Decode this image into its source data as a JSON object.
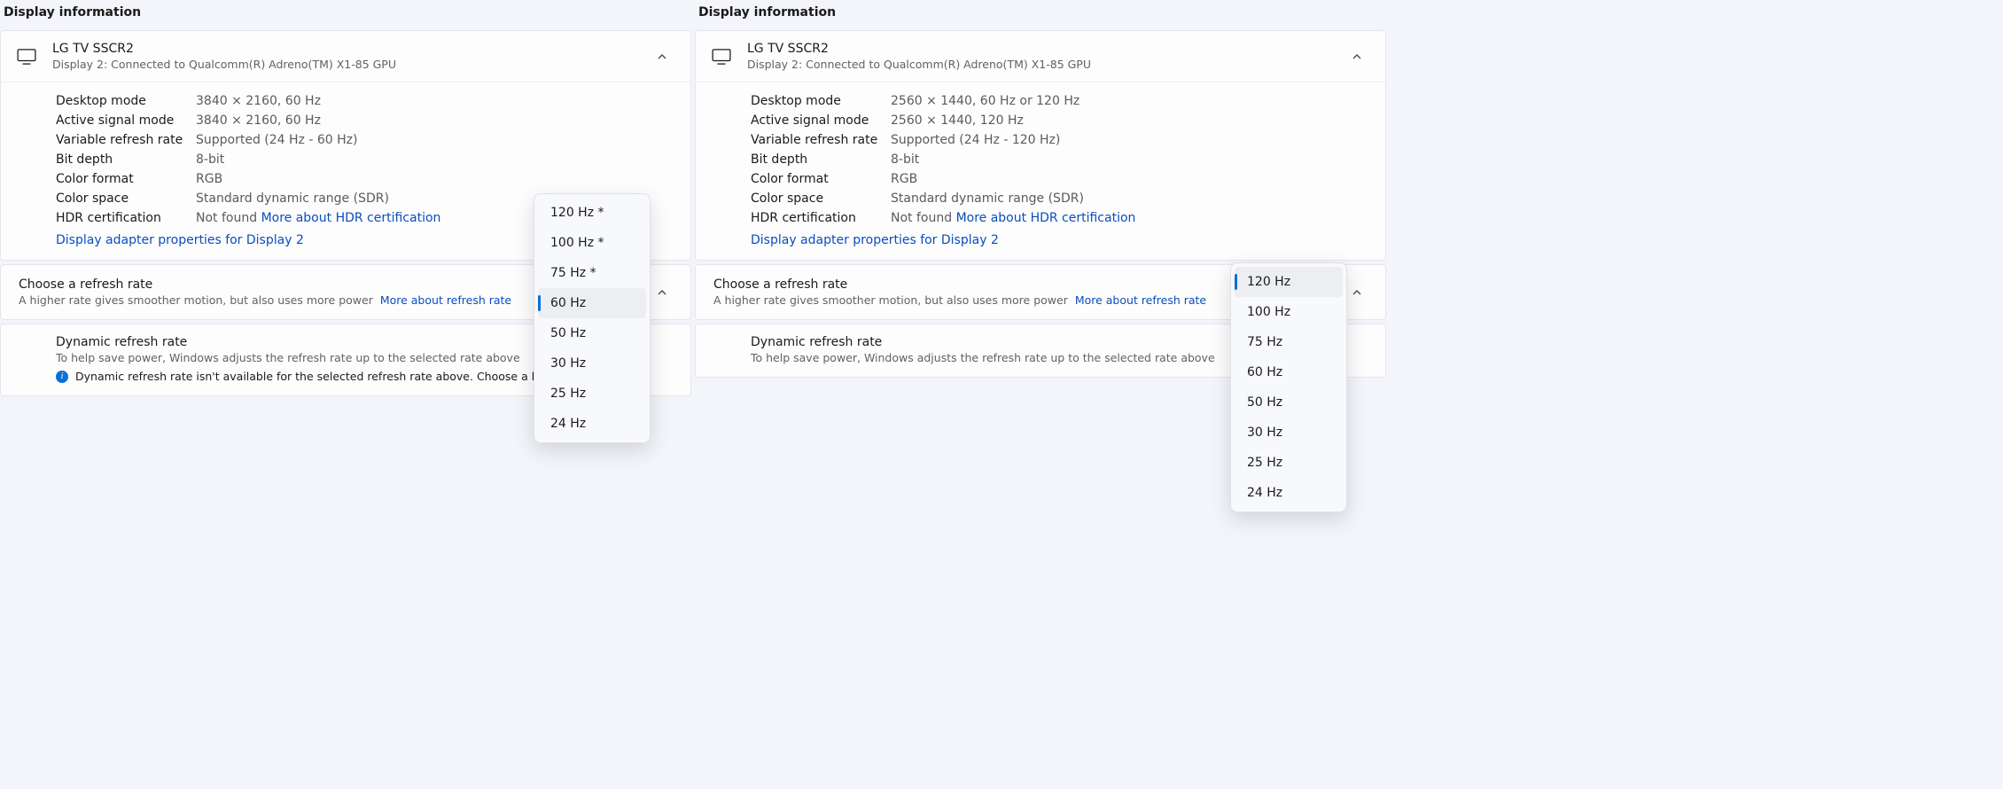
{
  "left": {
    "section_title": "Display information",
    "display": {
      "name": "LG TV SSCR2",
      "subtitle": "Display 2: Connected to Qualcomm(R) Adreno(TM) X1-85 GPU"
    },
    "props": {
      "desktop_mode": {
        "label": "Desktop mode",
        "value": "3840 × 2160, 60 Hz"
      },
      "active_signal": {
        "label": "Active signal mode",
        "value": "3840 × 2160, 60 Hz"
      },
      "vrr": {
        "label": "Variable refresh rate",
        "value": "Supported (24 Hz - 60 Hz)"
      },
      "bit_depth": {
        "label": "Bit depth",
        "value": "8-bit"
      },
      "color_format": {
        "label": "Color format",
        "value": "RGB"
      },
      "color_space": {
        "label": "Color space",
        "value": "Standard dynamic range (SDR)"
      },
      "hdr": {
        "label": "HDR certification",
        "value": "Not found",
        "link": "More about HDR certification"
      }
    },
    "adapter_link": "Display adapter properties for Display 2",
    "refresh": {
      "title": "Choose a refresh rate",
      "desc": "A higher rate gives smoother motion, but also uses more power",
      "link": "More about refresh rate"
    },
    "dynamic": {
      "title": "Dynamic refresh rate",
      "desc": "To help save power, Windows adjusts the refresh rate up to the selected rate above",
      "info": "Dynamic refresh rate isn't available for the selected refresh rate above. Choose a higher rate."
    },
    "dropdown": {
      "options": [
        "120 Hz *",
        "100 Hz *",
        "75 Hz *",
        "60 Hz",
        "50 Hz",
        "30 Hz",
        "25 Hz",
        "24 Hz"
      ],
      "selected_index": 3
    }
  },
  "right": {
    "section_title": "Display information",
    "display": {
      "name": "LG TV SSCR2",
      "subtitle": "Display 2: Connected to Qualcomm(R) Adreno(TM) X1-85 GPU"
    },
    "props": {
      "desktop_mode": {
        "label": "Desktop mode",
        "value": "2560 × 1440, 60 Hz or 120 Hz"
      },
      "active_signal": {
        "label": "Active signal mode",
        "value": "2560 × 1440, 120 Hz"
      },
      "vrr": {
        "label": "Variable refresh rate",
        "value": "Supported (24 Hz - 120 Hz)"
      },
      "bit_depth": {
        "label": "Bit depth",
        "value": "8-bit"
      },
      "color_format": {
        "label": "Color format",
        "value": "RGB"
      },
      "color_space": {
        "label": "Color space",
        "value": "Standard dynamic range (SDR)"
      },
      "hdr": {
        "label": "HDR certification",
        "value": "Not found",
        "link": "More about HDR certification"
      }
    },
    "adapter_link": "Display adapter properties for Display 2",
    "refresh": {
      "title": "Choose a refresh rate",
      "desc": "A higher rate gives smoother motion, but also uses more power",
      "link": "More about refresh rate"
    },
    "dynamic": {
      "title": "Dynamic refresh rate",
      "desc": "To help save power, Windows adjusts the refresh rate up to the selected rate above"
    },
    "dropdown": {
      "options": [
        "120 Hz",
        "100 Hz",
        "75 Hz",
        "60 Hz",
        "50 Hz",
        "30 Hz",
        "25 Hz",
        "24 Hz"
      ],
      "selected_index": 0
    }
  }
}
